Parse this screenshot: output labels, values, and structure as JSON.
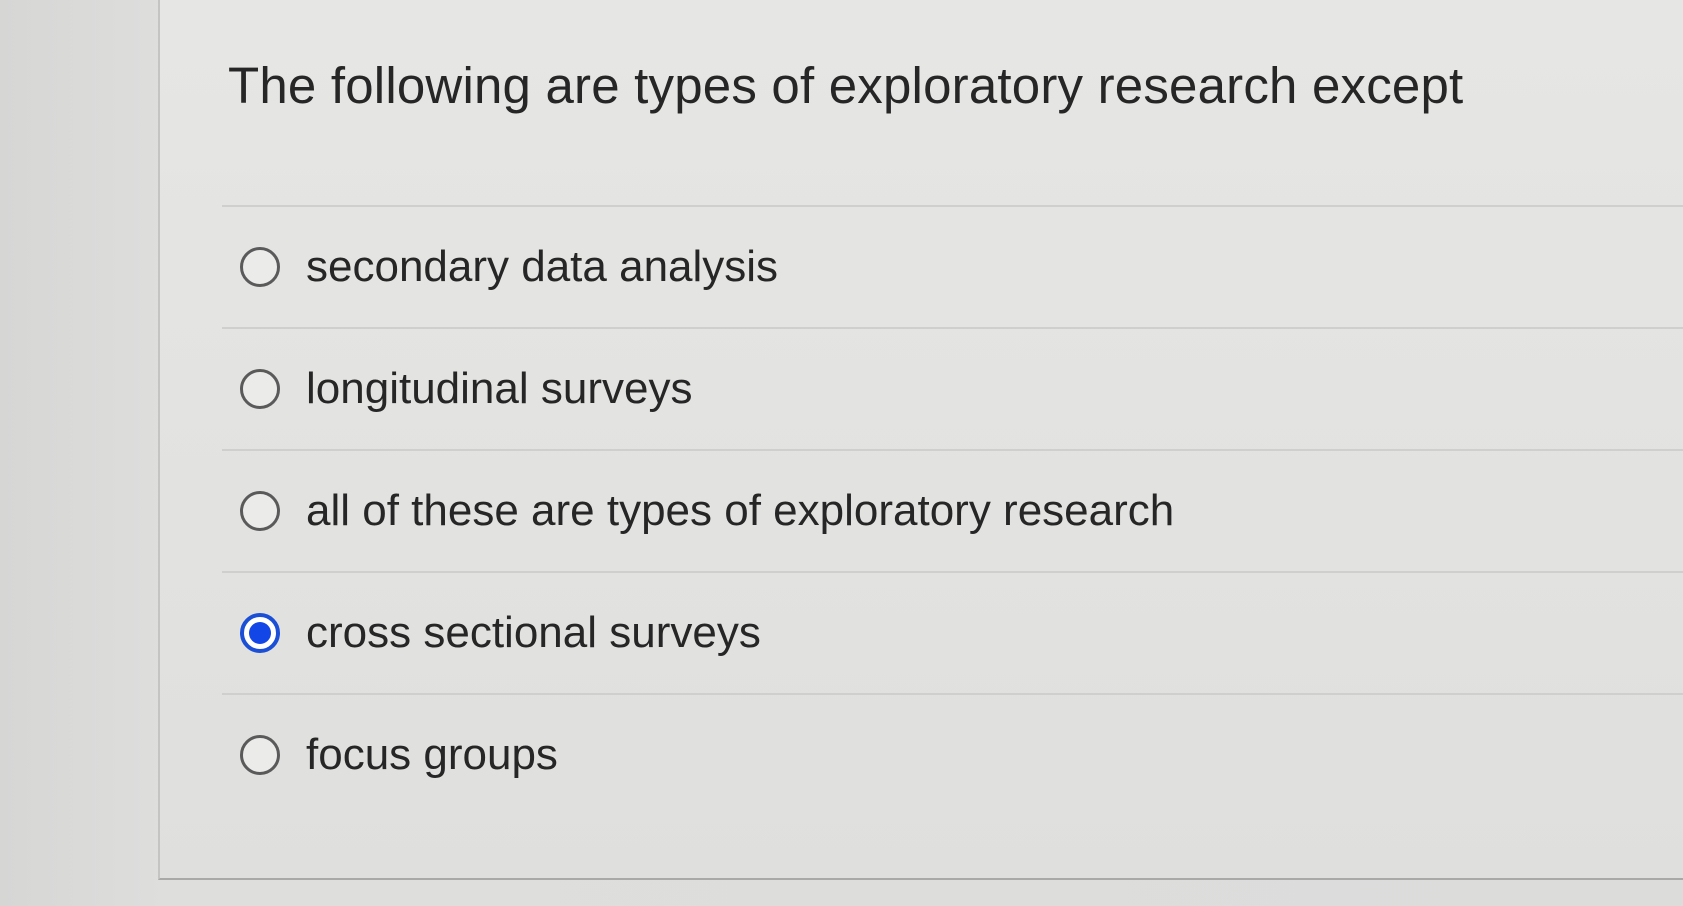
{
  "question": {
    "text": "The following are types of exploratory research except"
  },
  "options": [
    {
      "label": "secondary data analysis",
      "selected": false
    },
    {
      "label": "longitudinal surveys",
      "selected": false
    },
    {
      "label": "all of these are types of exploratory research",
      "selected": false
    },
    {
      "label": "cross sectional surveys",
      "selected": true
    },
    {
      "label": "focus groups",
      "selected": false
    }
  ],
  "colors": {
    "radio_selected": "#1346e6",
    "text": "#262626",
    "background": "#e3e3e1"
  }
}
